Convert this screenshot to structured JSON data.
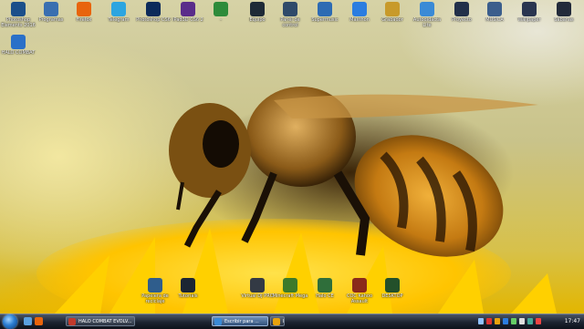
{
  "desktop": {
    "icons_top": [
      {
        "label": "Photoshop Elements 2016",
        "icon": "photoshop-elements-icon",
        "color": "#1b4f8a"
      },
      {
        "label": "Programas",
        "icon": "programs-folder-icon",
        "color": "#3a6fb0"
      },
      {
        "label": "Firefox",
        "icon": "firefox-icon",
        "color": "#e8640c"
      },
      {
        "label": "Telegram",
        "icon": "telegram-icon",
        "color": "#2ca5e0"
      },
      {
        "label": "Photoshop CS6",
        "icon": "photoshop-icon",
        "color": "#0b2a5a"
      },
      {
        "label": "iPad3D CS6 2",
        "icon": "ipad-app-icon",
        "color": "#5a2c8a"
      },
      {
        "label": "-",
        "icon": "alien-icon",
        "color": "#2e8b3a"
      },
      {
        "label": "Equipo",
        "icon": "computer-icon",
        "color": "#1e2a36"
      },
      {
        "label": "Panel de control",
        "icon": "control-panel-icon",
        "color": "#2f4a6a"
      },
      {
        "label": "Supermusic",
        "icon": "music-app-icon",
        "color": "#2d6bb3"
      },
      {
        "label": "Maxthon",
        "icon": "maxthon-icon",
        "color": "#2b7de0"
      },
      {
        "label": "Grabador",
        "icon": "recorder-icon",
        "color": "#c89a2a"
      },
      {
        "label": "Autodidacta Lite",
        "icon": "tutorial-app-icon",
        "color": "#3a8ad6"
      },
      {
        "label": "Proyecto",
        "icon": "project-folder-icon",
        "color": "#22304a"
      },
      {
        "label": "MUSICA",
        "icon": "music-folder-icon",
        "color": "#3b5e8c"
      },
      {
        "label": "Wallpaper",
        "icon": "wallpaper-folder-icon",
        "color": "#2a3550"
      },
      {
        "label": "Sábanas",
        "icon": "folder-icon",
        "color": "#222a3a"
      }
    ],
    "icon_left_second_row": {
      "label": "HALO COMBAT",
      "icon": "halo-shortcut-icon",
      "color": "#2a70c8"
    },
    "icons_bottom": [
      {
        "label": "Papelera de reciclaje",
        "icon": "recycle-bin-icon",
        "color": "#2f5d8c"
      },
      {
        "label": "Tutorials",
        "icon": "tutorials-folder-icon",
        "color": "#1c2533"
      },
      {
        "label": "Virtual DJ PRO",
        "icon": "virtualdj-icon",
        "color": "#333a44"
      },
      {
        "label": "Minecraft Mega",
        "icon": "minecraft-icon",
        "color": "#3d7a2a"
      },
      {
        "label": "Halo CE",
        "icon": "halo-ce-icon",
        "color": "#2f6e3a"
      },
      {
        "label": "COC Kahoo Assault",
        "icon": "game-shortcut-icon",
        "color": "#8a2a1a"
      },
      {
        "label": "DESKTOP",
        "icon": "desktop-shortcut-icon",
        "color": "#23502a"
      }
    ]
  },
  "taskbar": {
    "quick_launch": [
      {
        "icon": "show-desktop-icon",
        "color": "#5aa0e0"
      },
      {
        "icon": "firefox-quicklaunch-icon",
        "color": "#e8640c"
      }
    ],
    "tasks": [
      {
        "label": "HALO COMBAT EVOLV...",
        "icon": "halo-task-icon",
        "color": "#c0392b",
        "active": false
      },
      {
        "label": "Escribir para ...",
        "icon": "wordpad-task-icon",
        "color": "#3a8ad6",
        "active": true
      },
      {
        "label": "B...",
        "icon": "browser-task-icon",
        "color": "#e8a20c",
        "active": false
      }
    ],
    "tray_icons": [
      {
        "icon": "network-icon",
        "color": "#8fc1ff"
      },
      {
        "icon": "antivirus-icon",
        "color": "#d33"
      },
      {
        "icon": "update-icon",
        "color": "#e8a20c"
      },
      {
        "icon": "bluetooth-icon",
        "color": "#2b7de0"
      },
      {
        "icon": "app-tray-icon",
        "color": "#6c6"
      },
      {
        "icon": "volume-icon",
        "color": "#ddd"
      },
      {
        "icon": "language-icon",
        "color": "#4a9"
      },
      {
        "icon": "flag-icon",
        "color": "#e44"
      }
    ],
    "clock": "17:47"
  }
}
